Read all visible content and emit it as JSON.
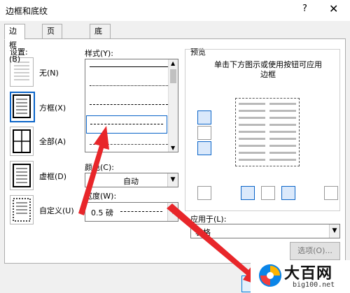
{
  "window": {
    "title": "边框和底纹",
    "help": "?",
    "close": "✕"
  },
  "tabs": [
    {
      "label": "边框(B)"
    },
    {
      "label": "页面边框(P)"
    },
    {
      "label": "底纹(S)"
    }
  ],
  "settings": {
    "heading": "设置:",
    "items": [
      {
        "label": "无(N)"
      },
      {
        "label": "方框(X)"
      },
      {
        "label": "全部(A)"
      },
      {
        "label": "虚框(D)"
      },
      {
        "label": "自定义(U)"
      }
    ]
  },
  "style": {
    "heading": "样式(Y):"
  },
  "color": {
    "heading": "颜色(C):",
    "value": "自动"
  },
  "width": {
    "heading": "宽度(W):",
    "value": "0.5 磅"
  },
  "preview": {
    "heading": "预览",
    "hint": "单击下方图示或使用按钮可应用边框"
  },
  "apply_to": {
    "heading": "应用于(L):",
    "value": "表格"
  },
  "options_button": "选项(O)...",
  "watermark": {
    "title": "大百网",
    "url": "big100.net"
  },
  "accent_color": "#0a64c8",
  "arrow_color": "#e8262a"
}
